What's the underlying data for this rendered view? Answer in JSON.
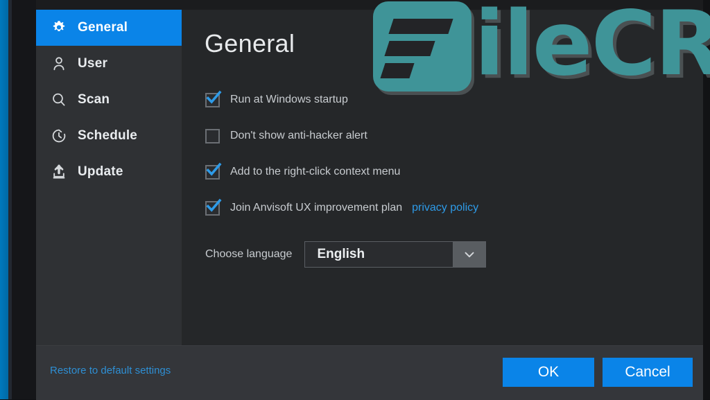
{
  "app": {
    "accent_color": "#0a84e8",
    "link_color": "#2e9be8",
    "sidebar_bg": "#2f3134",
    "content_bg": "#252729",
    "footer_bg": "#34363a"
  },
  "sidebar": {
    "items": [
      {
        "label": "General",
        "icon": "gear-icon",
        "selected": true
      },
      {
        "label": "User",
        "icon": "user-icon",
        "selected": false
      },
      {
        "label": "Scan",
        "icon": "search-icon",
        "selected": false
      },
      {
        "label": "Schedule",
        "icon": "clock-icon",
        "selected": false
      },
      {
        "label": "Update",
        "icon": "upload-icon",
        "selected": false
      }
    ]
  },
  "main": {
    "title": "General",
    "options": [
      {
        "label": "Run at Windows startup",
        "checked": true
      },
      {
        "label": "Don't show anti-hacker alert",
        "checked": false
      },
      {
        "label": "Add to the right-click context menu",
        "checked": true
      },
      {
        "label": "Join Anvisoft UX improvement plan",
        "checked": true,
        "link": "privacy policy"
      }
    ],
    "language": {
      "label": "Choose language",
      "value": "English",
      "options": [
        "English"
      ],
      "arrow_icon": "chevron-down-icon"
    }
  },
  "footer": {
    "restore_label": "Restore to default settings",
    "ok_label": "OK",
    "cancel_label": "Cancel"
  },
  "watermark": {
    "text": "ileCR",
    "color": "#3f9498"
  }
}
